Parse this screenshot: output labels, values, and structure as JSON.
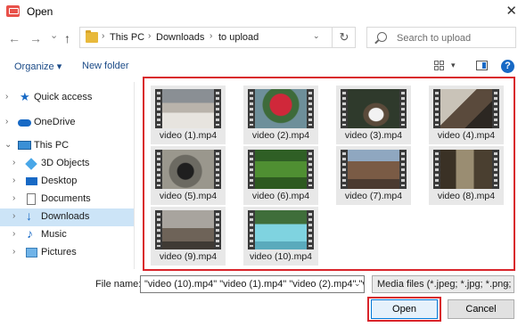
{
  "window": {
    "title": "Open",
    "close_glyph": "✕"
  },
  "nav": {
    "back": "←",
    "forward": "→",
    "history": "⌄",
    "up": "↑",
    "breadcrumb": [
      "This PC",
      "Downloads",
      "to upload"
    ],
    "separator": "›",
    "search_placeholder": "Search to upload",
    "refresh": "↻"
  },
  "toolbar": {
    "organize": "Organize ▾",
    "new_folder": "New folder",
    "help": "?"
  },
  "sidebar": {
    "items": [
      {
        "label": "Quick access",
        "icon": "star-icon"
      },
      {
        "label": "OneDrive",
        "icon": "cloud-icon"
      },
      {
        "label": "This PC",
        "icon": "computer-icon"
      },
      {
        "label": "3D Objects",
        "icon": "cube-icon"
      },
      {
        "label": "Desktop",
        "icon": "desktop-icon"
      },
      {
        "label": "Documents",
        "icon": "document-icon"
      },
      {
        "label": "Downloads",
        "icon": "download-icon",
        "selected": true
      },
      {
        "label": "Music",
        "icon": "music-icon"
      },
      {
        "label": "Pictures",
        "icon": "picture-icon"
      }
    ]
  },
  "files": [
    {
      "name": "video (1).mp4"
    },
    {
      "name": "video (2).mp4"
    },
    {
      "name": "video (3).mp4"
    },
    {
      "name": "video (4).mp4"
    },
    {
      "name": "video (5).mp4"
    },
    {
      "name": "video (6).mp4"
    },
    {
      "name": "video (7).mp4"
    },
    {
      "name": "video (8).mp4"
    },
    {
      "name": "video (9).mp4"
    },
    {
      "name": "video (10).mp4"
    }
  ],
  "footer": {
    "file_name_label": "File name:",
    "file_name_value": "\"video (10).mp4\" \"video (1).mp4\" \"video (2).mp4\" \"v",
    "filter": "Media files (*.jpeg; *.jpg; *.png;",
    "open": "Open",
    "cancel": "Cancel"
  },
  "colors": {
    "highlight": "#d9242b",
    "selection": "#cce4f7",
    "link": "#1a4a87"
  }
}
